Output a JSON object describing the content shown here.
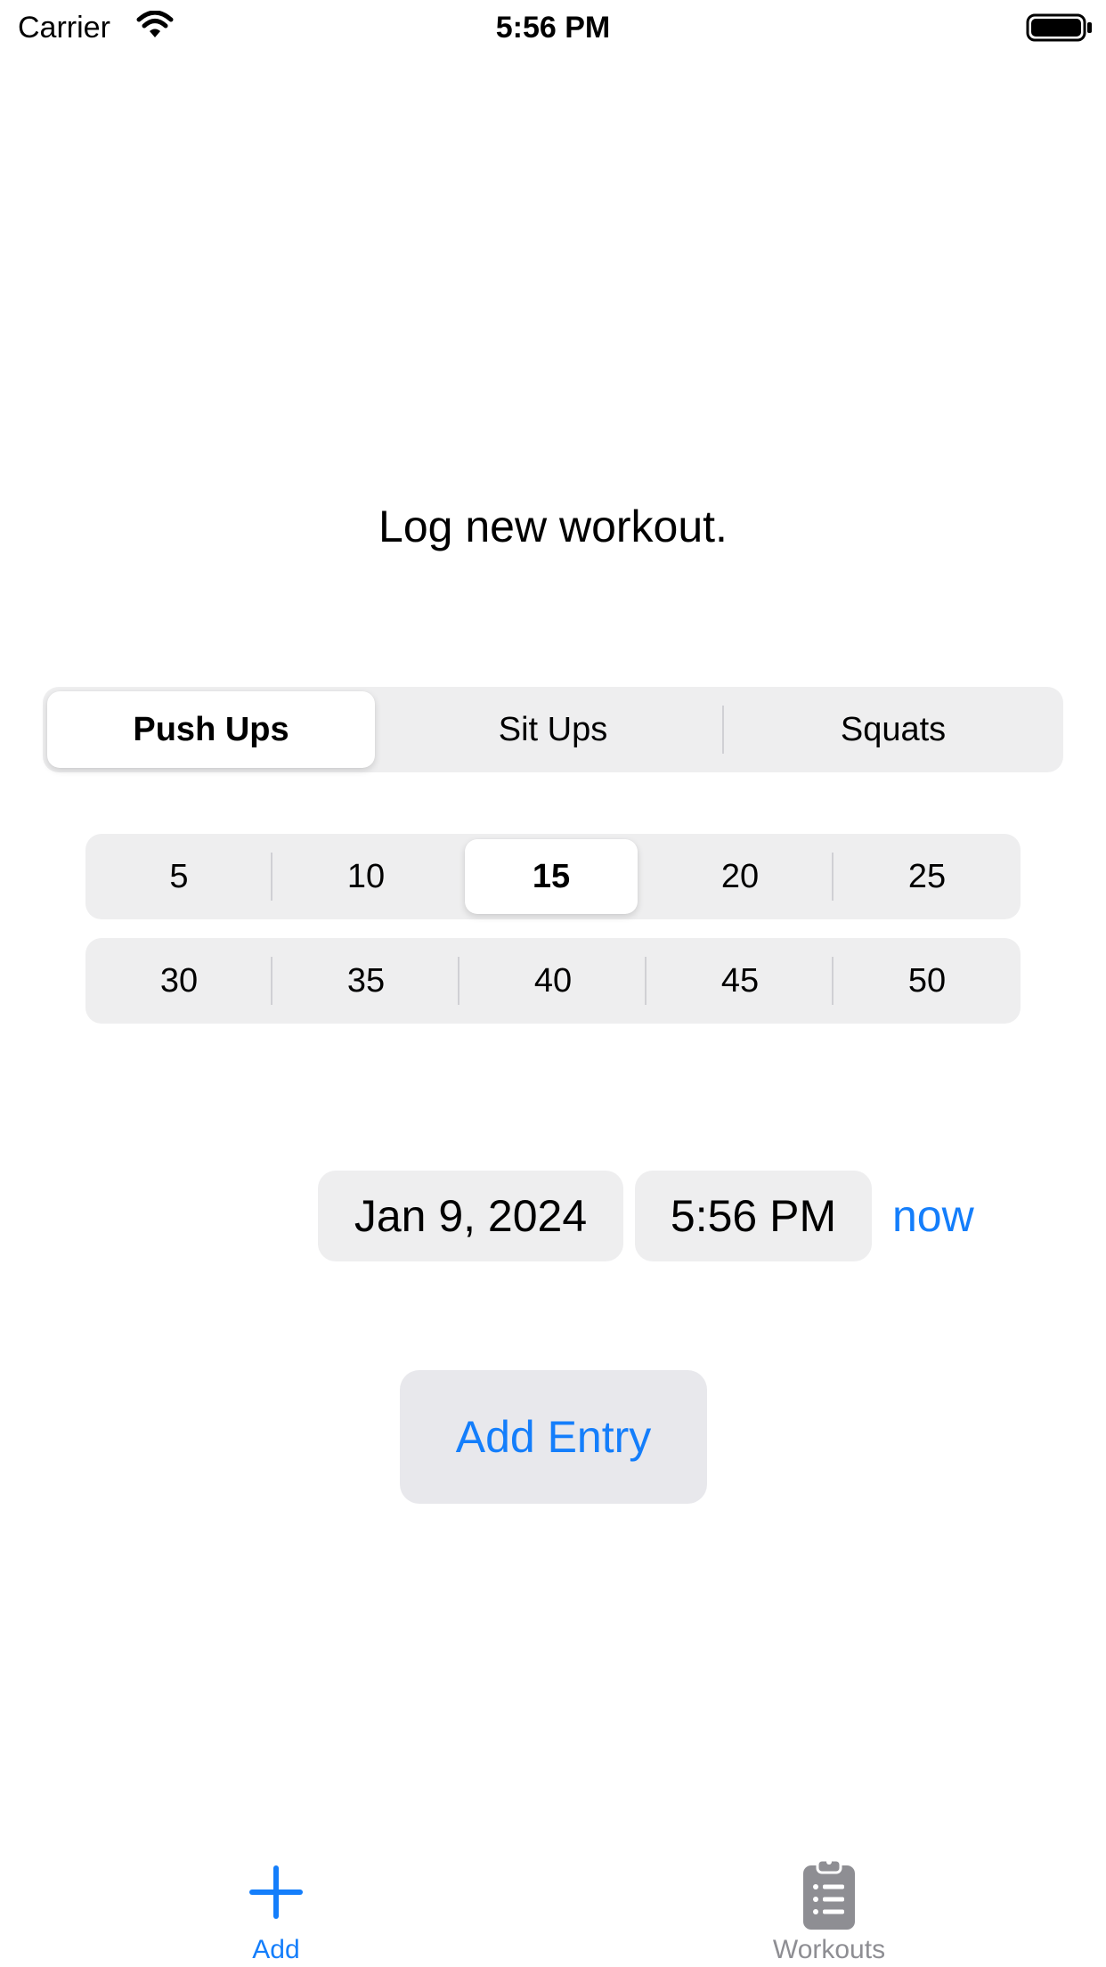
{
  "status_bar": {
    "carrier": "Carrier",
    "time": "5:56 PM",
    "wifi_icon": "wifi-icon",
    "battery_icon": "battery-full-icon"
  },
  "main": {
    "title": "Log new workout.",
    "exercise_segment": {
      "options": [
        "Push Ups",
        "Sit Ups",
        "Squats"
      ],
      "selected": "Push Ups"
    },
    "reps_segment": {
      "row1": [
        "5",
        "10",
        "15",
        "20",
        "25"
      ],
      "row2": [
        "30",
        "35",
        "40",
        "45",
        "50"
      ],
      "selected": "15"
    },
    "date": "Jan 9, 2024",
    "time": "5:56 PM",
    "now_label": "now",
    "add_entry_label": "Add Entry"
  },
  "tab_bar": {
    "tabs": [
      {
        "label": "Add",
        "icon": "plus-icon",
        "selected": true
      },
      {
        "label": "Workouts",
        "icon": "clipboard-list-icon",
        "selected": false
      }
    ]
  },
  "colors": {
    "accent": "#147efb",
    "control_background": "#eeeeef",
    "inactive_tab": "#8e8e93"
  }
}
